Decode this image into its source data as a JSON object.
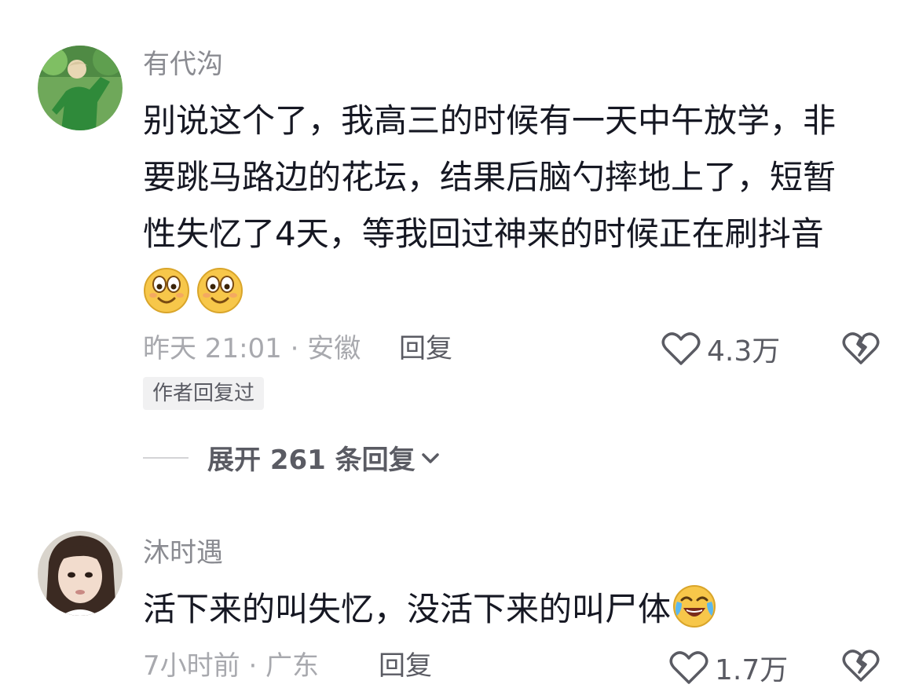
{
  "comments": [
    {
      "username": "有代沟",
      "text_lines": [
        "别说这个了，我高三的时候有一天中午放学，非",
        "要跳马路边的花坛，结果后脑勺摔地上了，短暂",
        "性失忆了4天，等我回过神来的时候正在刷抖音"
      ],
      "emojis": [
        "smile-emoji",
        "smile-emoji"
      ],
      "time_location": "昨天 21:01 · 安徽",
      "reply_label": "回复",
      "like_count": "4.3万",
      "author_badge": "作者回复过",
      "expand_label": "展开 261 条回复"
    },
    {
      "username": "沐时遇",
      "text": "活下来的叫失忆，没活下来的叫尸体",
      "emojis": [
        "crying-laughing-emoji"
      ],
      "time_location": "7小时前 · 广东",
      "reply_label": "回复",
      "like_count": "1.7万"
    }
  ],
  "icons": {
    "like": "heart-outline-icon",
    "dislike": "broken-heart-icon",
    "expand": "chevron-down-icon"
  },
  "colors": {
    "text_primary": "#161823",
    "text_secondary": "#8a8b91",
    "text_meta": "#a8a9ae",
    "action": "#5a5b63",
    "badge_bg": "#f1f1f2",
    "emoji_yellow": "#f7c74a"
  }
}
